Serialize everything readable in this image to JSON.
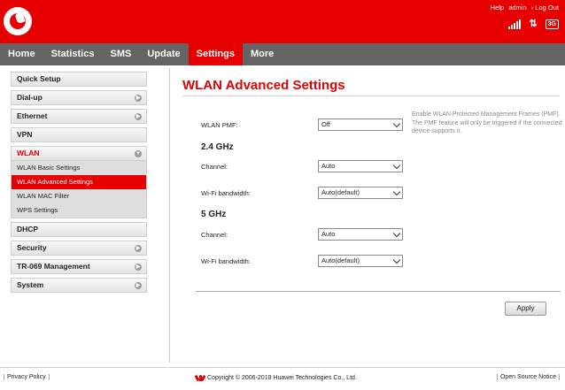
{
  "header": {
    "brand_color": "#e60000",
    "links": {
      "help": "Help",
      "user": "admin",
      "logout": "› Log Out"
    },
    "status": {
      "signal_icon": "signal-bars-icon",
      "data_icon": "updown-arrows-icon",
      "network_type": "3G"
    }
  },
  "nav": {
    "tabs": [
      {
        "label": "Home"
      },
      {
        "label": "Statistics"
      },
      {
        "label": "SMS"
      },
      {
        "label": "Update"
      },
      {
        "label": "Settings",
        "active": true
      },
      {
        "label": "More"
      }
    ]
  },
  "sidebar": {
    "items": [
      {
        "label": "Quick Setup"
      },
      {
        "label": "Dial-up",
        "chevron": true
      },
      {
        "label": "Ethernet",
        "chevron": true
      },
      {
        "label": "VPN"
      },
      {
        "label": "WLAN",
        "chevron": true,
        "open": true
      },
      {
        "label": "DHCP"
      },
      {
        "label": "Security",
        "chevron": true
      },
      {
        "label": "TR-069 Management",
        "chevron": true
      },
      {
        "label": "System",
        "chevron": true
      }
    ],
    "wlan_sub": [
      {
        "label": "WLAN Basic Settings"
      },
      {
        "label": "WLAN Advanced Settings",
        "active": true
      },
      {
        "label": "WLAN MAC Filter"
      },
      {
        "label": "WPS Settings"
      }
    ]
  },
  "main": {
    "title": "WLAN Advanced Settings",
    "pmf": {
      "label": "WLAN PMF:",
      "value": "Off",
      "hint": "Enable WLAN Protected Management Frames (PMF). The PMF feature will only be triggered if the connected device supports it."
    },
    "band_24": {
      "title": "2.4 GHz",
      "channel_label": "Channel:",
      "channel_value": "Auto",
      "bandwidth_label": "Wi-Fi bandwidth:",
      "bandwidth_value": "Auto(default)"
    },
    "band_5": {
      "title": "5 GHz",
      "channel_label": "Channel:",
      "channel_value": "Auto",
      "bandwidth_label": "Wi-Fi bandwidth:",
      "bandwidth_value": "Auto(default)"
    },
    "apply_label": "Apply"
  },
  "footer": {
    "privacy": "Privacy Policy",
    "copyright": "Copyright © 2006-2018 Huawei Technologies Co., Ltd.",
    "open_source": "Open Source Notice"
  }
}
